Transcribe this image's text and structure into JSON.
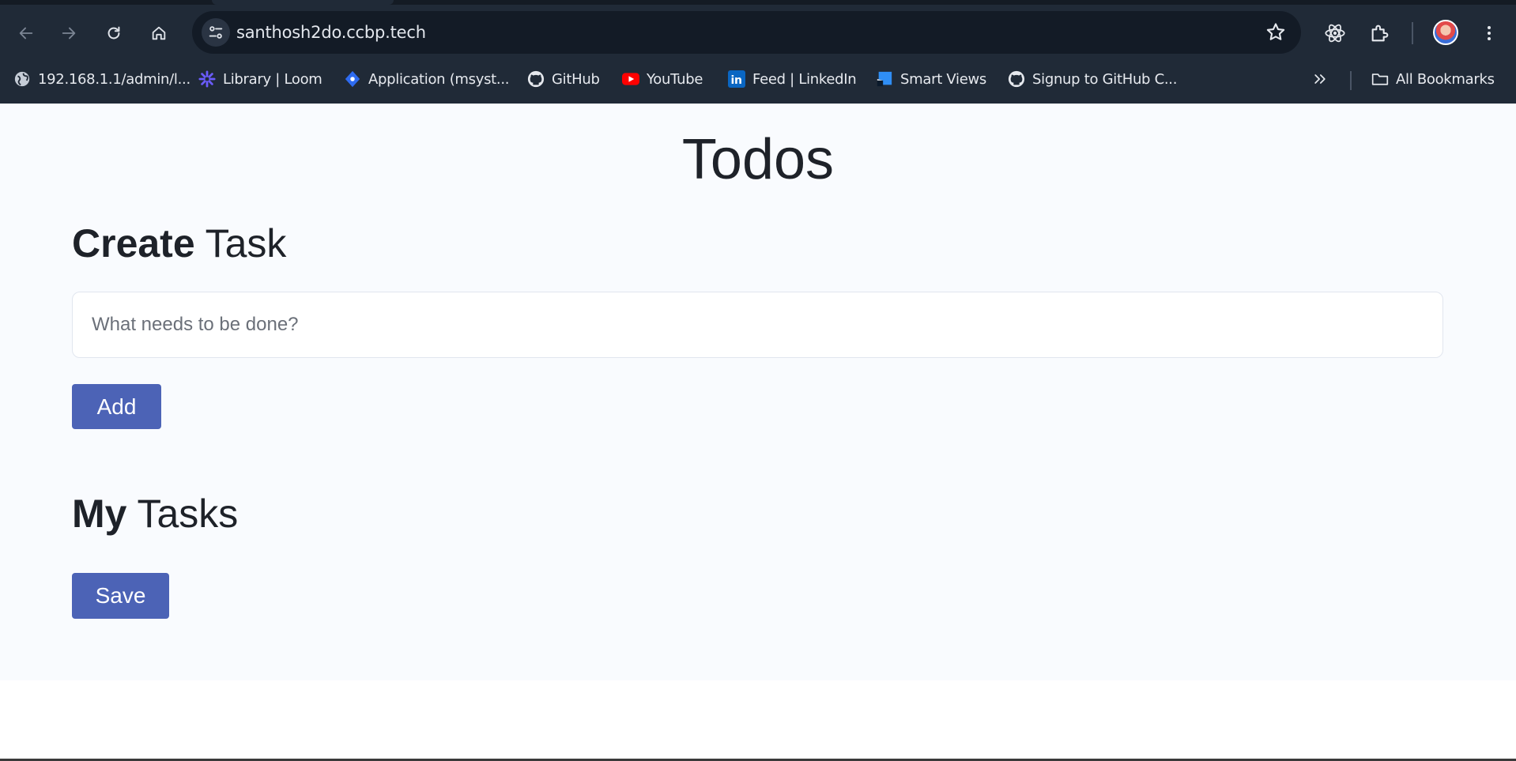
{
  "browser": {
    "url": "santhosh2do.ccbp.tech",
    "bookmarks": [
      {
        "label": "192.168.1.1/admin/l...",
        "icon": "globe-icon"
      },
      {
        "label": "Library | Loom",
        "icon": "loom-icon"
      },
      {
        "label": "Application (msyst...",
        "icon": "azure-devops-icon"
      },
      {
        "label": "GitHub",
        "icon": "github-icon"
      },
      {
        "label": "YouTube",
        "icon": "youtube-icon"
      },
      {
        "label": "Feed | LinkedIn",
        "icon": "linkedin-icon"
      },
      {
        "label": "Smart Views",
        "icon": "smart-views-icon"
      },
      {
        "label": "Signup to GitHub C...",
        "icon": "github-icon"
      }
    ],
    "all_bookmarks_label": "All Bookmarks"
  },
  "page": {
    "title": "Todos",
    "create_heading_bold": "Create",
    "create_heading_rest": " Task",
    "input_placeholder": "What needs to be done?",
    "input_value": "",
    "add_label": "Add",
    "my_heading_bold": "My",
    "my_heading_rest": " Tasks",
    "save_label": "Save"
  },
  "colors": {
    "chrome_bg": "#202a37",
    "page_bg": "#f9fbfe",
    "button_bg": "#4c63b6",
    "heading_text": "#1e2229"
  }
}
